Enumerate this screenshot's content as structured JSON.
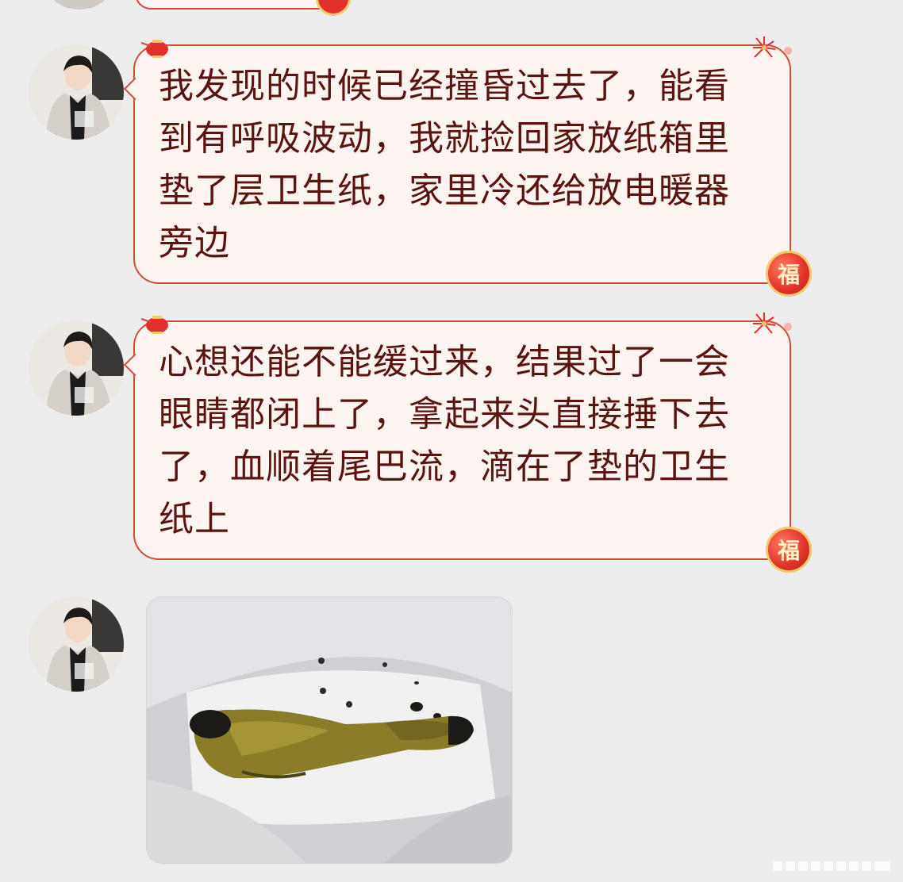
{
  "messages": [
    {
      "type": "text",
      "text": "我发现的时候已经撞昏过去了，能看到有呼吸波动，我就捡回家放纸箱里垫了层卫生纸，家里冷还给放电暖器旁边",
      "badge": "福"
    },
    {
      "type": "text",
      "text": "心想还能不能缓过来，结果过了一会眼睛都闭上了，拿起来头直接捶下去了，血顺着尾巴流，滴在了垫的卫生纸上",
      "badge": "福"
    },
    {
      "type": "image",
      "image_desc": "dead-bird-in-box"
    }
  ],
  "colors": {
    "bubble_border": "#d24a3c",
    "bubble_bg": "#fdf3f1",
    "text": "#5a1410",
    "background": "#ededed"
  }
}
